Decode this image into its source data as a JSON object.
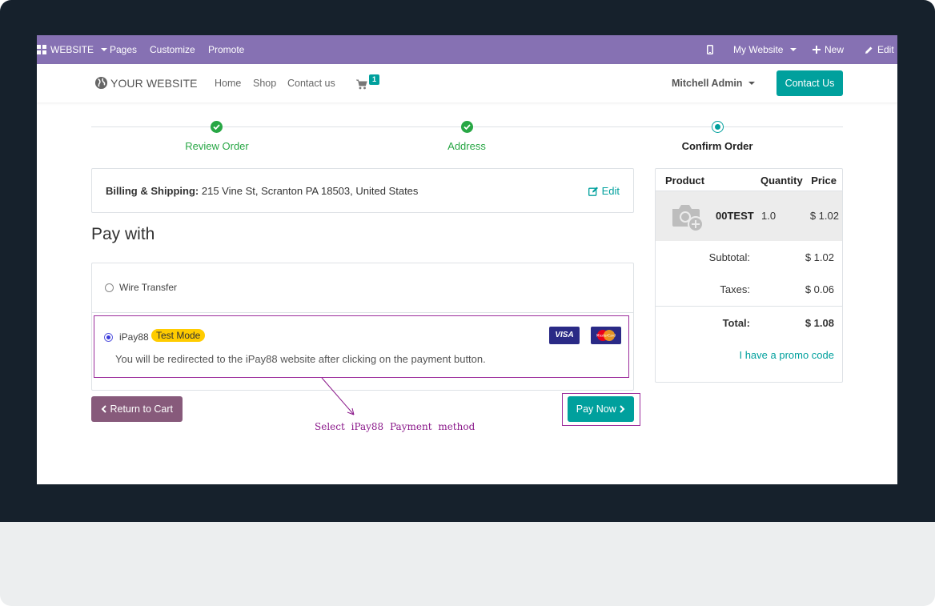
{
  "admin_bar": {
    "website_menu": "WEBSITE",
    "pages": "Pages",
    "customize": "Customize",
    "promote": "Promote",
    "my_website": "My Website",
    "new": "New",
    "edit": "Edit",
    "icons": {
      "mobile": "mobile-icon",
      "plus": "plus-icon",
      "pencil": "pencil-icon",
      "apps": "apps-grid-icon"
    }
  },
  "header": {
    "logo_text": "YOUR WEBSITE",
    "nav": [
      "Home",
      "Shop",
      "Contact us"
    ],
    "cart_count": "1",
    "user": "Mitchell Admin",
    "contact_button": "Contact Us"
  },
  "steps": [
    {
      "label": "Review Order",
      "state": "done"
    },
    {
      "label": "Address",
      "state": "done"
    },
    {
      "label": "Confirm Order",
      "state": "current"
    }
  ],
  "billing": {
    "label": "Billing & Shipping:",
    "address": " 215 Vine St, Scranton PA 18503, United States",
    "edit": "Edit"
  },
  "pay_with": {
    "title": "Pay with",
    "methods": [
      {
        "name": "Wire Transfer",
        "selected": false
      },
      {
        "name": "iPay88",
        "selected": true,
        "badge": "Test Mode",
        "cards": [
          "VISA",
          "MasterCard"
        ],
        "description": "You will be redirected to the iPay88 website after clicking on the payment button."
      }
    ]
  },
  "buttons": {
    "return": "Return to Cart",
    "pay_now": "Pay Now"
  },
  "annotation": "Select iPay88 Payment method",
  "summary": {
    "headers": [
      "Product",
      "Quantity",
      "Price"
    ],
    "items": [
      {
        "name": "00TEST",
        "qty": "1.0",
        "price": "$ 1.02"
      }
    ],
    "subtotal_label": "Subtotal:",
    "subtotal": "$ 1.02",
    "taxes_label": "Taxes:",
    "taxes": "$ 0.06",
    "total_label": "Total:",
    "total": "$ 1.08",
    "promo": "I have a promo code"
  },
  "colors": {
    "admin_bar": "#8671b3",
    "primary": "#00a09d",
    "secondary": "#875a7b",
    "success": "#28a745",
    "annotation": "#8b1a8b"
  }
}
